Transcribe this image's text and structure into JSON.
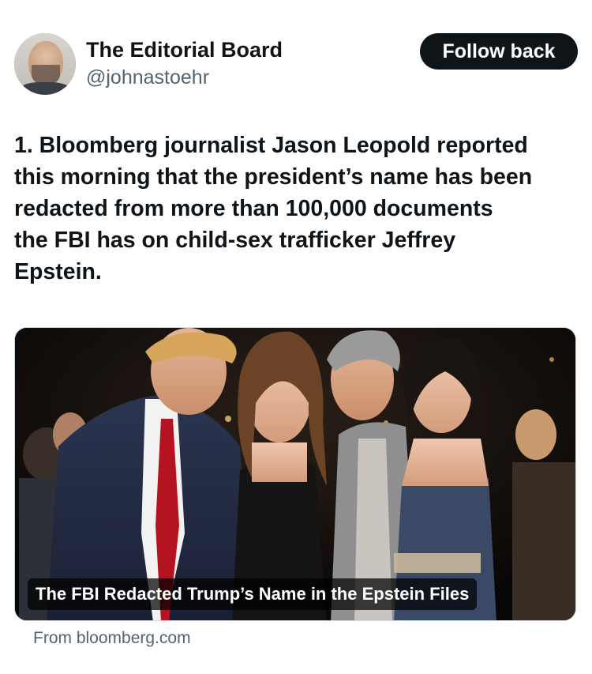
{
  "author": {
    "name": "The Editorial Board",
    "handle": "@johnastoehr"
  },
  "actions": {
    "follow_label": "Follow back"
  },
  "tweet": {
    "text_lines": [
      "1. Bloomberg journalist Jason Leopold reported",
      "this morning that the president’s name has been",
      "redacted from more than 100,000 documents",
      "the FBI has on child-sex trafficker Jeffrey",
      "Epstein."
    ]
  },
  "card": {
    "title": "The FBI Redacted Trump’s Name in the Epstein Files",
    "source": "From bloomberg.com"
  },
  "colors": {
    "text": "#0f1419",
    "secondary": "#536471",
    "button_bg": "#0f1419",
    "button_text": "#ffffff"
  }
}
